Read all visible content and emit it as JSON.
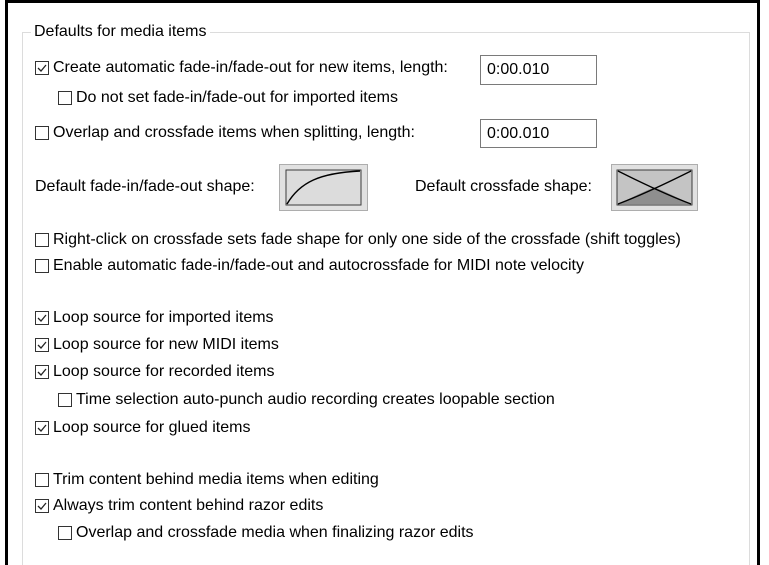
{
  "group_title": "Defaults for media items",
  "options": {
    "create_auto_fade": {
      "label": "Create automatic fade-in/fade-out for new items, length:",
      "checked": true
    },
    "no_fade_imported": {
      "label": "Do not set fade-in/fade-out for imported items",
      "checked": false
    },
    "overlap_split": {
      "label": "Overlap and crossfade items when splitting, length:",
      "checked": false
    },
    "right_click_one_side": {
      "label": "Right-click on crossfade sets fade shape for only one side of the crossfade (shift toggles)",
      "checked": false
    },
    "midi_velocity_fades": {
      "label": "Enable automatic fade-in/fade-out and autocrossfade for MIDI note velocity",
      "checked": false
    },
    "loop_imported": {
      "label": "Loop source for imported items",
      "checked": true
    },
    "loop_new_midi": {
      "label": "Loop source for new MIDI items",
      "checked": true
    },
    "loop_recorded": {
      "label": "Loop source for recorded items",
      "checked": true
    },
    "auto_punch_loopable": {
      "label": "Time selection auto-punch audio recording creates loopable section",
      "checked": false
    },
    "loop_glued": {
      "label": "Loop source for glued items",
      "checked": true
    },
    "trim_behind_items": {
      "label": "Trim content behind media items when editing",
      "checked": false
    },
    "trim_behind_razor": {
      "label": "Always trim content behind razor edits",
      "checked": true
    },
    "crossfade_razor_finalize": {
      "label": "Overlap and crossfade media when finalizing razor edits",
      "checked": false
    }
  },
  "fields": {
    "auto_fade_length": "0:00.010",
    "split_crossfade_length": "0:00.010"
  },
  "shapes": {
    "fade_label": "Default fade-in/fade-out shape:",
    "fade_icon": "fade-curve-icon",
    "crossfade_label": "Default crossfade shape:",
    "crossfade_icon": "crossfade-x-icon"
  }
}
